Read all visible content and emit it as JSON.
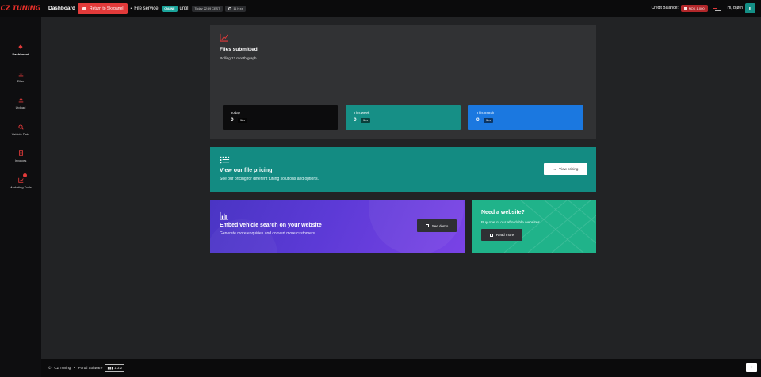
{
  "brand": {
    "logo_text": "CZ TUNING",
    "accent": "#e23a3a",
    "teal": "#138b82"
  },
  "header": {
    "title": "Dashboard",
    "return_label": "Return to Skypanel",
    "dot": "•",
    "file_service_label": "File service:",
    "status": "ONLINE",
    "until": "until",
    "until_time": "Today 22:59 CEST",
    "duration": "11 h xx",
    "credit_label": "Credit Balance:",
    "credit_value": "NOK 1,000",
    "greeting": "Hi, Bjørn",
    "avatar_initial": "B"
  },
  "sidebar": {
    "items": [
      {
        "label": "Dashboard",
        "icon": "diamond-icon"
      },
      {
        "label": "Files",
        "icon": "download-icon"
      },
      {
        "label": "Upload",
        "icon": "upload-icon"
      },
      {
        "label": "Vehicle Data",
        "icon": "search-icon"
      },
      {
        "label": "Invoices",
        "icon": "invoice-icon"
      },
      {
        "label": "Marketing Tools",
        "icon": "chart-icon"
      }
    ]
  },
  "files_card": {
    "title": "Files submitted",
    "subtitle": "Rolling 12 month graph",
    "stats": [
      {
        "label": "Today",
        "value": "0",
        "unit": "files",
        "color": "#0c0c0d"
      },
      {
        "label": "This week",
        "value": "0",
        "unit": "files",
        "color": "#168f86"
      },
      {
        "label": "This month",
        "value": "0",
        "unit": "files",
        "color": "#1b78e0"
      }
    ]
  },
  "pricing_card": {
    "title": "View our file pricing",
    "subtitle": "See our pricing for different tuning solutions and options.",
    "button": "View pricing"
  },
  "embed_card": {
    "title": "Embed vehicle search on your website",
    "subtitle": "Generate more enquiries and convert more customers",
    "button": "See demo"
  },
  "website_card": {
    "title": "Need a website?",
    "subtitle": "Buy one of our affordable websites",
    "button": "Read more"
  },
  "footer": {
    "copyright": "©",
    "company": "CZ Tuning",
    "dot": "•",
    "product": "Portal Software",
    "version": "▮▮▮ 1.3.2"
  }
}
